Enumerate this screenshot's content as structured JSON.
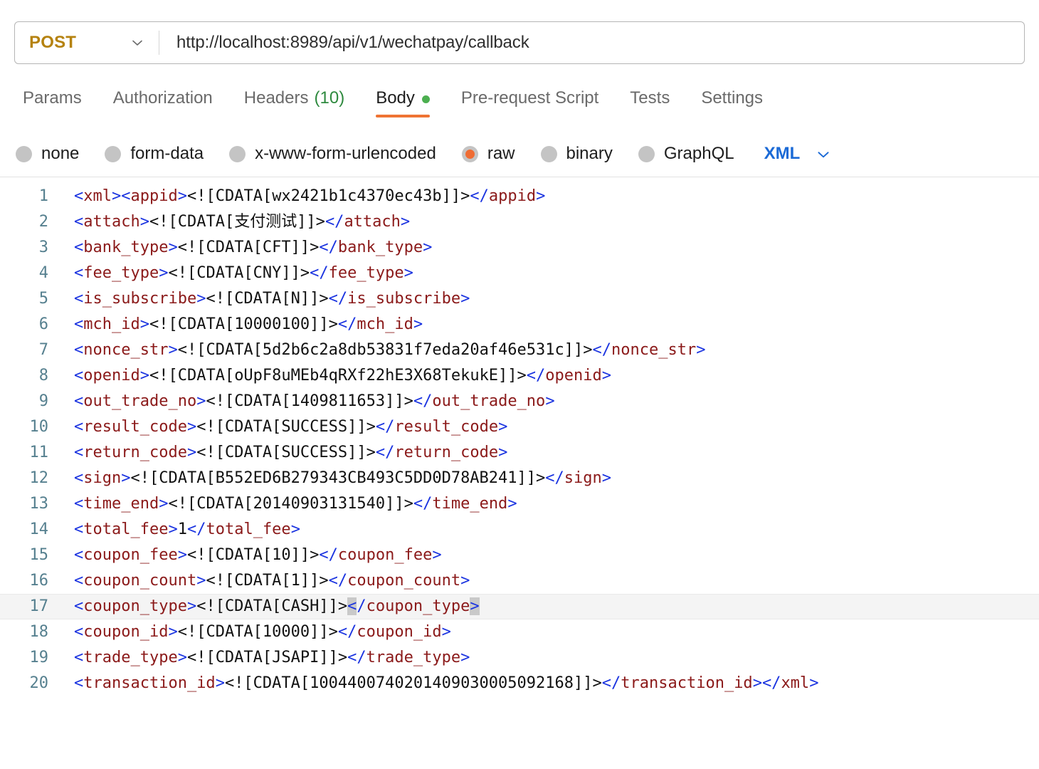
{
  "request": {
    "method": "POST",
    "method_chevron_icon": "chevron-down-icon",
    "url": "http://localhost:8989/api/v1/wechatpay/callback"
  },
  "tabs": [
    {
      "label": "Params",
      "active": false
    },
    {
      "label": "Authorization",
      "active": false
    },
    {
      "label": "Headers",
      "count": "(10)",
      "active": false
    },
    {
      "label": "Body",
      "active": true,
      "dot": true
    },
    {
      "label": "Pre-request Script",
      "active": false
    },
    {
      "label": "Tests",
      "active": false
    },
    {
      "label": "Settings",
      "active": false
    }
  ],
  "body_types": [
    {
      "label": "none",
      "selected": false
    },
    {
      "label": "form-data",
      "selected": false
    },
    {
      "label": "x-www-form-urlencoded",
      "selected": false
    },
    {
      "label": "raw",
      "selected": true
    },
    {
      "label": "binary",
      "selected": false
    },
    {
      "label": "GraphQL",
      "selected": false
    }
  ],
  "language": {
    "label": "XML",
    "chevron_icon": "chevron-down-icon"
  },
  "colors": {
    "method": "#b5820f",
    "accent_underline": "#ef7333",
    "radio_selected": "#ef6c33",
    "body_dot": "#4caf50",
    "headers_count": "#2f8a3f",
    "language": "#1b6ad6",
    "gutter": "#56808f",
    "xml_bracket": "#1a33e0",
    "xml_tag": "#8b1a1a",
    "xml_text": "#111111",
    "active_line_bg": "#f4f4f4",
    "bracket_match_bg": "#c9c9c9"
  },
  "editor": {
    "active_line": 17,
    "lines": [
      {
        "n": "1",
        "tokens": [
          {
            "t": "br",
            "v": "<"
          },
          {
            "t": "tag",
            "v": "xml"
          },
          {
            "t": "br",
            "v": ">"
          },
          {
            "t": "br",
            "v": "<"
          },
          {
            "t": "tag",
            "v": "appid"
          },
          {
            "t": "br",
            "v": ">"
          },
          {
            "t": "txt",
            "v": "<![CDATA[wx2421b1c4370ec43b]]>"
          },
          {
            "t": "br",
            "v": "</"
          },
          {
            "t": "tag",
            "v": "appid"
          },
          {
            "t": "br",
            "v": ">"
          }
        ]
      },
      {
        "n": "2",
        "tokens": [
          {
            "t": "br",
            "v": "<"
          },
          {
            "t": "tag",
            "v": "attach"
          },
          {
            "t": "br",
            "v": ">"
          },
          {
            "t": "txt",
            "v": "<![CDATA[支付测试]]>"
          },
          {
            "t": "br",
            "v": "</"
          },
          {
            "t": "tag",
            "v": "attach"
          },
          {
            "t": "br",
            "v": ">"
          }
        ]
      },
      {
        "n": "3",
        "tokens": [
          {
            "t": "br",
            "v": "<"
          },
          {
            "t": "tag",
            "v": "bank_type"
          },
          {
            "t": "br",
            "v": ">"
          },
          {
            "t": "txt",
            "v": "<![CDATA[CFT]]>"
          },
          {
            "t": "br",
            "v": "</"
          },
          {
            "t": "tag",
            "v": "bank_type"
          },
          {
            "t": "br",
            "v": ">"
          }
        ]
      },
      {
        "n": "4",
        "tokens": [
          {
            "t": "br",
            "v": "<"
          },
          {
            "t": "tag",
            "v": "fee_type"
          },
          {
            "t": "br",
            "v": ">"
          },
          {
            "t": "txt",
            "v": "<![CDATA[CNY]]>"
          },
          {
            "t": "br",
            "v": "</"
          },
          {
            "t": "tag",
            "v": "fee_type"
          },
          {
            "t": "br",
            "v": ">"
          }
        ]
      },
      {
        "n": "5",
        "tokens": [
          {
            "t": "br",
            "v": "<"
          },
          {
            "t": "tag",
            "v": "is_subscribe"
          },
          {
            "t": "br",
            "v": ">"
          },
          {
            "t": "txt",
            "v": "<![CDATA[N]]>"
          },
          {
            "t": "br",
            "v": "</"
          },
          {
            "t": "tag",
            "v": "is_subscribe"
          },
          {
            "t": "br",
            "v": ">"
          }
        ]
      },
      {
        "n": "6",
        "tokens": [
          {
            "t": "br",
            "v": "<"
          },
          {
            "t": "tag",
            "v": "mch_id"
          },
          {
            "t": "br",
            "v": ">"
          },
          {
            "t": "txt",
            "v": "<![CDATA[10000100]]>"
          },
          {
            "t": "br",
            "v": "</"
          },
          {
            "t": "tag",
            "v": "mch_id"
          },
          {
            "t": "br",
            "v": ">"
          }
        ]
      },
      {
        "n": "7",
        "tokens": [
          {
            "t": "br",
            "v": "<"
          },
          {
            "t": "tag",
            "v": "nonce_str"
          },
          {
            "t": "br",
            "v": ">"
          },
          {
            "t": "txt",
            "v": "<![CDATA[5d2b6c2a8db53831f7eda20af46e531c]]>"
          },
          {
            "t": "br",
            "v": "</"
          },
          {
            "t": "tag",
            "v": "nonce_str"
          },
          {
            "t": "br",
            "v": ">"
          }
        ]
      },
      {
        "n": "8",
        "tokens": [
          {
            "t": "br",
            "v": "<"
          },
          {
            "t": "tag",
            "v": "openid"
          },
          {
            "t": "br",
            "v": ">"
          },
          {
            "t": "txt",
            "v": "<![CDATA[oUpF8uMEb4qRXf22hE3X68TekukE]]>"
          },
          {
            "t": "br",
            "v": "</"
          },
          {
            "t": "tag",
            "v": "openid"
          },
          {
            "t": "br",
            "v": ">"
          }
        ]
      },
      {
        "n": "9",
        "tokens": [
          {
            "t": "br",
            "v": "<"
          },
          {
            "t": "tag",
            "v": "out_trade_no"
          },
          {
            "t": "br",
            "v": ">"
          },
          {
            "t": "txt",
            "v": "<![CDATA[1409811653]]>"
          },
          {
            "t": "br",
            "v": "</"
          },
          {
            "t": "tag",
            "v": "out_trade_no"
          },
          {
            "t": "br",
            "v": ">"
          }
        ]
      },
      {
        "n": "10",
        "tokens": [
          {
            "t": "br",
            "v": "<"
          },
          {
            "t": "tag",
            "v": "result_code"
          },
          {
            "t": "br",
            "v": ">"
          },
          {
            "t": "txt",
            "v": "<![CDATA[SUCCESS]]>"
          },
          {
            "t": "br",
            "v": "</"
          },
          {
            "t": "tag",
            "v": "result_code"
          },
          {
            "t": "br",
            "v": ">"
          }
        ]
      },
      {
        "n": "11",
        "tokens": [
          {
            "t": "br",
            "v": "<"
          },
          {
            "t": "tag",
            "v": "return_code"
          },
          {
            "t": "br",
            "v": ">"
          },
          {
            "t": "txt",
            "v": "<![CDATA[SUCCESS]]>"
          },
          {
            "t": "br",
            "v": "</"
          },
          {
            "t": "tag",
            "v": "return_code"
          },
          {
            "t": "br",
            "v": ">"
          }
        ]
      },
      {
        "n": "12",
        "tokens": [
          {
            "t": "br",
            "v": "<"
          },
          {
            "t": "tag",
            "v": "sign"
          },
          {
            "t": "br",
            "v": ">"
          },
          {
            "t": "txt",
            "v": "<![CDATA[B552ED6B279343CB493C5DD0D78AB241]]>"
          },
          {
            "t": "br",
            "v": "</"
          },
          {
            "t": "tag",
            "v": "sign"
          },
          {
            "t": "br",
            "v": ">"
          }
        ]
      },
      {
        "n": "13",
        "tokens": [
          {
            "t": "br",
            "v": "<"
          },
          {
            "t": "tag",
            "v": "time_end"
          },
          {
            "t": "br",
            "v": ">"
          },
          {
            "t": "txt",
            "v": "<![CDATA[20140903131540]]>"
          },
          {
            "t": "br",
            "v": "</"
          },
          {
            "t": "tag",
            "v": "time_end"
          },
          {
            "t": "br",
            "v": ">"
          }
        ]
      },
      {
        "n": "14",
        "tokens": [
          {
            "t": "br",
            "v": "<"
          },
          {
            "t": "tag",
            "v": "total_fee"
          },
          {
            "t": "br",
            "v": ">"
          },
          {
            "t": "txt",
            "v": "1"
          },
          {
            "t": "br",
            "v": "</"
          },
          {
            "t": "tag",
            "v": "total_fee"
          },
          {
            "t": "br",
            "v": ">"
          }
        ]
      },
      {
        "n": "15",
        "tokens": [
          {
            "t": "br",
            "v": "<"
          },
          {
            "t": "tag",
            "v": "coupon_fee"
          },
          {
            "t": "br",
            "v": ">"
          },
          {
            "t": "txt",
            "v": "<![CDATA[10]]>"
          },
          {
            "t": "br",
            "v": "</"
          },
          {
            "t": "tag",
            "v": "coupon_fee"
          },
          {
            "t": "br",
            "v": ">"
          }
        ]
      },
      {
        "n": "16",
        "tokens": [
          {
            "t": "br",
            "v": "<"
          },
          {
            "t": "tag",
            "v": "coupon_count"
          },
          {
            "t": "br",
            "v": ">"
          },
          {
            "t": "txt",
            "v": "<![CDATA[1]]>"
          },
          {
            "t": "br",
            "v": "</"
          },
          {
            "t": "tag",
            "v": "coupon_count"
          },
          {
            "t": "br",
            "v": ">"
          }
        ]
      },
      {
        "n": "17",
        "tokens": [
          {
            "t": "br",
            "v": "<"
          },
          {
            "t": "tag",
            "v": "coupon_type"
          },
          {
            "t": "br",
            "v": ">"
          },
          {
            "t": "txt",
            "v": "<![CDATA[CASH]]>"
          },
          {
            "t": "match",
            "v": "<"
          },
          {
            "t": "br",
            "v": "/"
          },
          {
            "t": "tag",
            "v": "coupon_type"
          },
          {
            "t": "match",
            "v": ">"
          }
        ]
      },
      {
        "n": "18",
        "tokens": [
          {
            "t": "br",
            "v": "<"
          },
          {
            "t": "tag",
            "v": "coupon_id"
          },
          {
            "t": "br",
            "v": ">"
          },
          {
            "t": "txt",
            "v": "<![CDATA[10000]]>"
          },
          {
            "t": "br",
            "v": "</"
          },
          {
            "t": "tag",
            "v": "coupon_id"
          },
          {
            "t": "br",
            "v": ">"
          }
        ]
      },
      {
        "n": "19",
        "tokens": [
          {
            "t": "br",
            "v": "<"
          },
          {
            "t": "tag",
            "v": "trade_type"
          },
          {
            "t": "br",
            "v": ">"
          },
          {
            "t": "txt",
            "v": "<![CDATA[JSAPI]]>"
          },
          {
            "t": "br",
            "v": "</"
          },
          {
            "t": "tag",
            "v": "trade_type"
          },
          {
            "t": "br",
            "v": ">"
          }
        ]
      },
      {
        "n": "20",
        "tokens": [
          {
            "t": "br",
            "v": "<"
          },
          {
            "t": "tag",
            "v": "transaction_id"
          },
          {
            "t": "br",
            "v": ">"
          },
          {
            "t": "txt",
            "v": "<![CDATA[1004400740201409030005092168]]>"
          },
          {
            "t": "br",
            "v": "</"
          },
          {
            "t": "tag",
            "v": "transaction_id"
          },
          {
            "t": "br",
            "v": ">"
          },
          {
            "t": "br",
            "v": "</"
          },
          {
            "t": "tag",
            "v": "xml"
          },
          {
            "t": "br",
            "v": ">"
          }
        ]
      }
    ]
  }
}
